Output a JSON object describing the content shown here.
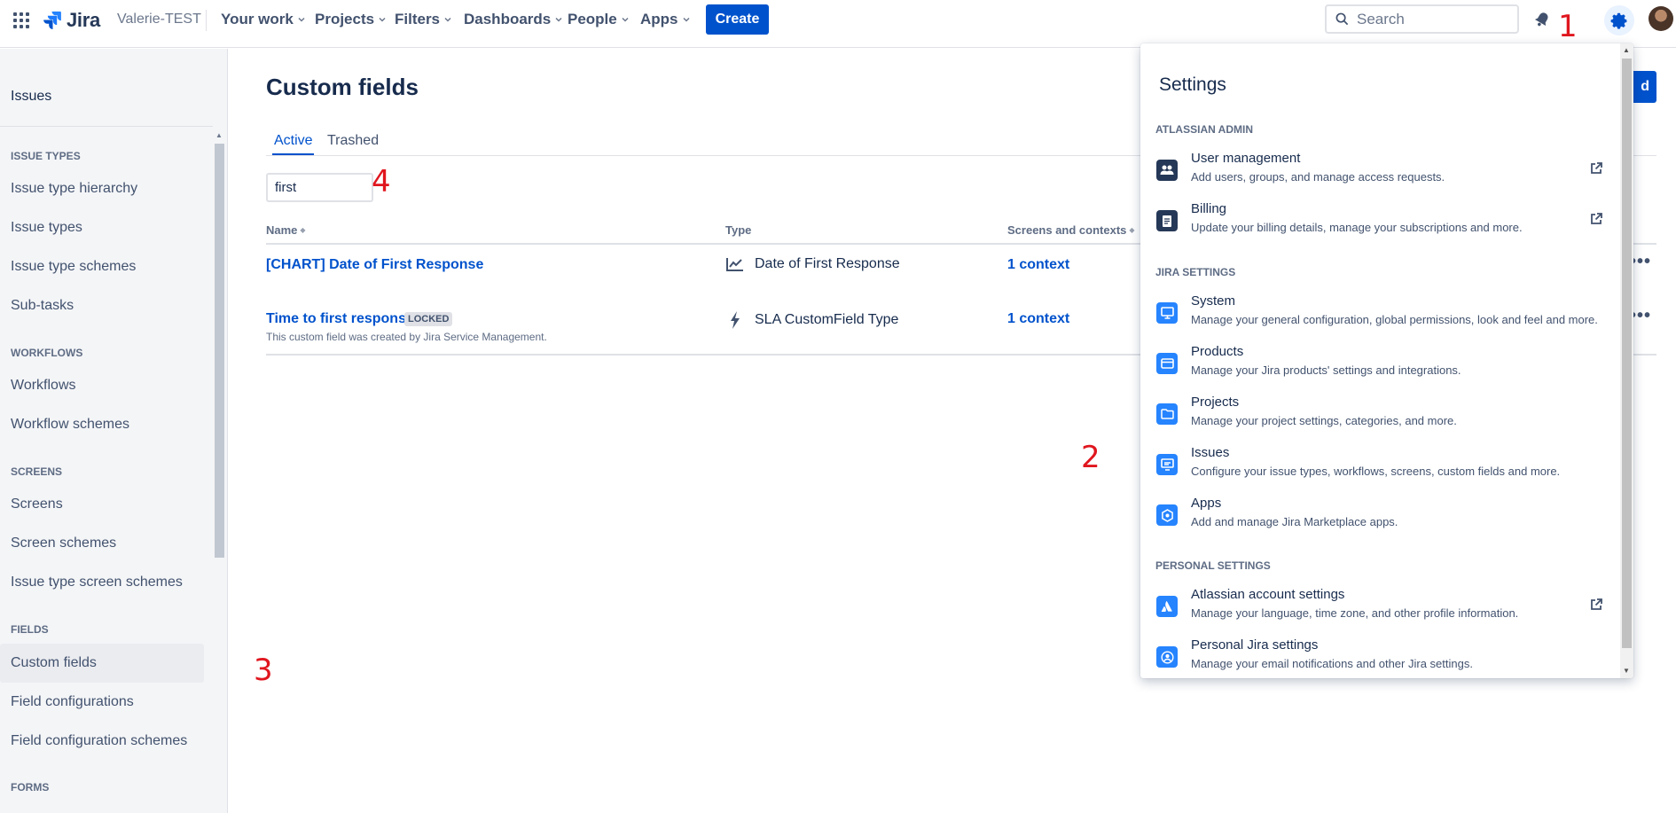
{
  "topnav": {
    "product": "Jira",
    "site": "Valerie-TEST",
    "items": [
      {
        "label": "Your work"
      },
      {
        "label": "Projects"
      },
      {
        "label": "Filters"
      },
      {
        "label": "Dashboards"
      },
      {
        "label": "People"
      },
      {
        "label": "Apps"
      }
    ],
    "create_label": "Create",
    "search_placeholder": "Search"
  },
  "sidebar": {
    "top_item": "Issues",
    "sections": [
      {
        "title": "ISSUE TYPES",
        "items": [
          "Issue type hierarchy",
          "Issue types",
          "Issue type schemes",
          "Sub-tasks"
        ]
      },
      {
        "title": "WORKFLOWS",
        "items": [
          "Workflows",
          "Workflow schemes"
        ]
      },
      {
        "title": "SCREENS",
        "items": [
          "Screens",
          "Screen schemes",
          "Issue type screen schemes"
        ]
      },
      {
        "title": "FIELDS",
        "items": [
          "Custom fields",
          "Field configurations",
          "Field configuration schemes"
        ]
      },
      {
        "title": "FORMS",
        "items": []
      }
    ],
    "active_item": "Custom fields"
  },
  "main": {
    "title": "Custom fields",
    "add_button_partial": "d",
    "tabs": [
      {
        "label": "Active",
        "active": true
      },
      {
        "label": "Trashed",
        "active": false
      }
    ],
    "filter_value": "first",
    "columns": [
      "Name",
      "Type",
      "Screens and contexts"
    ],
    "rows": [
      {
        "name": "[CHART] Date of First Response",
        "badge": "",
        "description": "",
        "type": "Date of First Response",
        "type_icon": "chart-line-icon",
        "contexts": "1 context"
      },
      {
        "name": "Time to first response",
        "badge": "LOCKED",
        "description": "This custom field was created by Jira Service Management.",
        "type": "SLA CustomField Type",
        "type_icon": "bolt-icon",
        "contexts": "1 context"
      }
    ]
  },
  "settings_panel": {
    "title": "Settings",
    "sections": [
      {
        "title": "ATLASSIAN ADMIN",
        "items": [
          {
            "label": "User management",
            "desc": "Add users, groups, and manage access requests.",
            "icon": "people-icon",
            "external": true
          },
          {
            "label": "Billing",
            "desc": "Update your billing details, manage your subscriptions and more.",
            "icon": "document-icon",
            "external": true
          }
        ]
      },
      {
        "title": "JIRA SETTINGS",
        "items": [
          {
            "label": "System",
            "desc": "Manage your general configuration, global permissions, look and feel and more.",
            "icon": "monitor-icon",
            "external": false
          },
          {
            "label": "Products",
            "desc": "Manage your Jira products' settings and integrations.",
            "icon": "card-icon",
            "external": false
          },
          {
            "label": "Projects",
            "desc": "Manage your project settings, categories, and more.",
            "icon": "folder-icon",
            "external": false
          },
          {
            "label": "Issues",
            "desc": "Configure your issue types, workflows, screens, custom fields and more.",
            "icon": "issues-icon",
            "external": false
          },
          {
            "label": "Apps",
            "desc": "Add and manage Jira Marketplace apps.",
            "icon": "apps-icon",
            "external": false
          }
        ]
      },
      {
        "title": "PERSONAL SETTINGS",
        "items": [
          {
            "label": "Atlassian account settings",
            "desc": "Manage your language, time zone, and other profile information.",
            "icon": "atlassian-icon",
            "external": true
          },
          {
            "label": "Personal Jira settings",
            "desc": "Manage your email notifications and other Jira settings.",
            "icon": "person-icon",
            "external": false
          }
        ]
      }
    ]
  },
  "annotations": [
    "1",
    "2",
    "3",
    "4"
  ],
  "colors": {
    "brand": "#0052cc",
    "annotation": "#e0161e",
    "icon_blue": "#2684ff",
    "icon_dark": "#253858"
  }
}
